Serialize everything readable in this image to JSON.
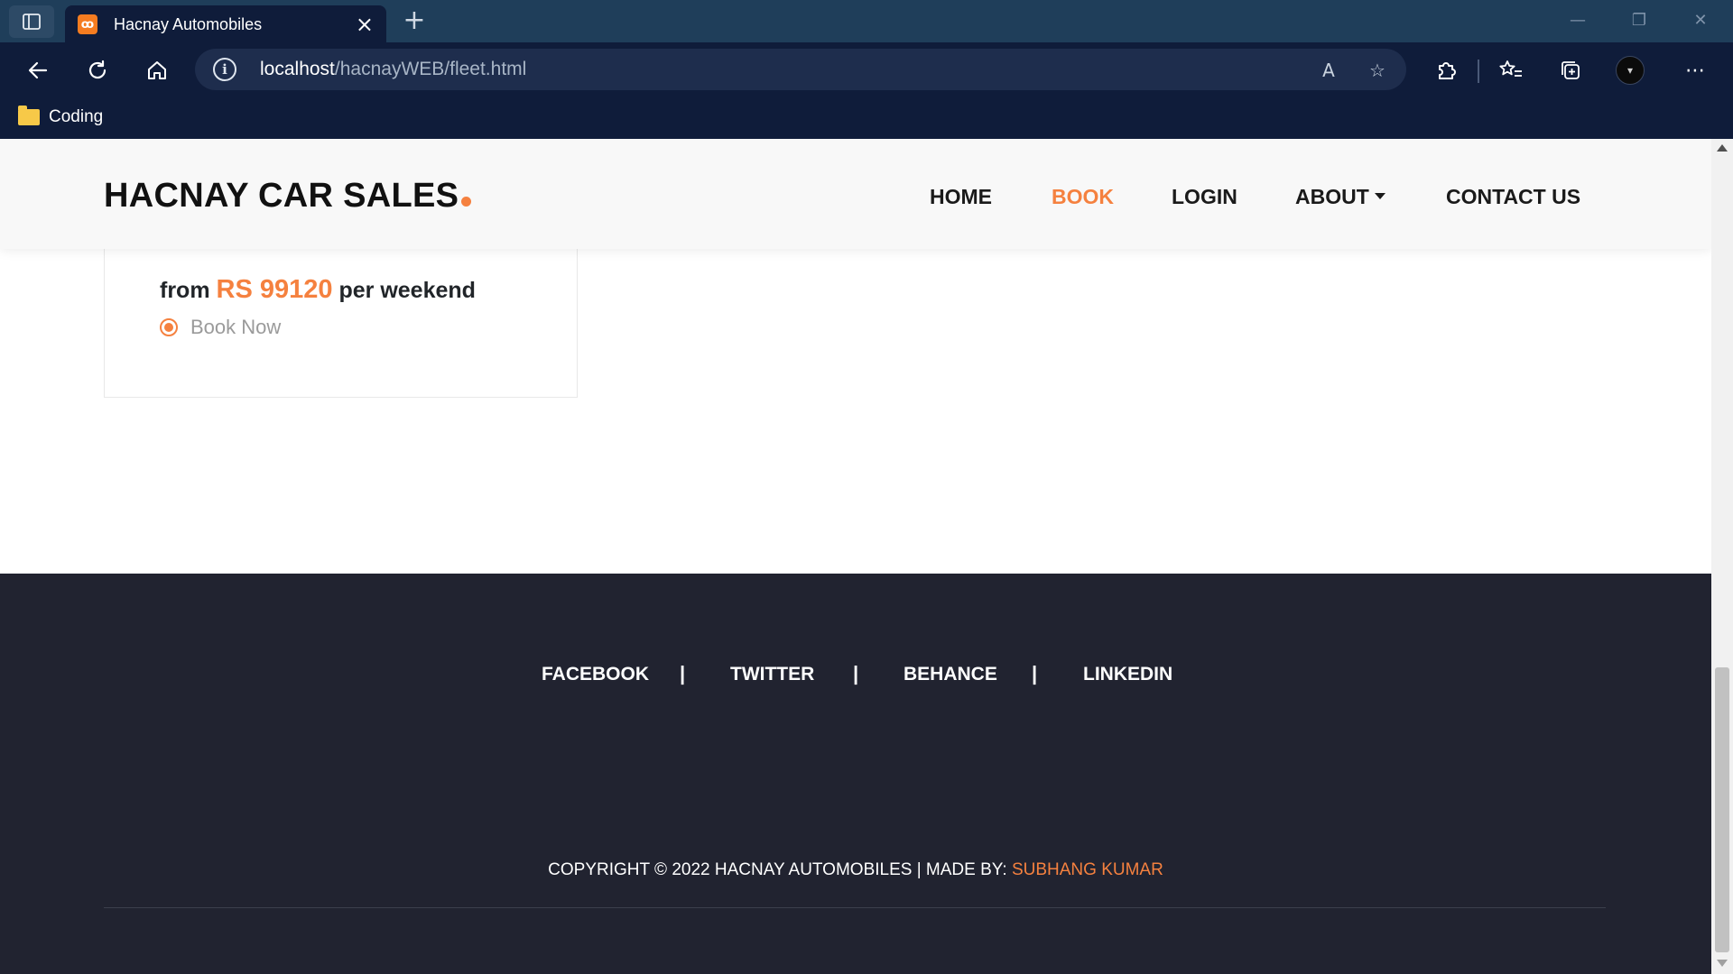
{
  "browser": {
    "tab_title": "Hacnay Automobiles",
    "tab_favicon": "xampp-icon",
    "new_tab_label": "+",
    "address_host": "localhost",
    "address_path": "/hacnayWEB/fleet.html",
    "bookmarks": [
      {
        "label": "Coding",
        "icon": "folder-icon"
      }
    ]
  },
  "header": {
    "logo": "HACNAY CAR SALES",
    "nav": [
      {
        "label": "HOME",
        "active": false
      },
      {
        "label": "BOOK",
        "active": true
      },
      {
        "label": "LOGIN",
        "active": false
      },
      {
        "label": "ABOUT",
        "active": false,
        "dropdown": true
      },
      {
        "label": "CONTACT US",
        "active": false
      }
    ],
    "accent_color": "#f5813f"
  },
  "card": {
    "price_prefix": "from",
    "price_amount": "RS 99120",
    "price_suffix": "per weekend",
    "book_label": "Book Now"
  },
  "footer": {
    "social_links": [
      "FACEBOOK",
      "TWITTER",
      "BEHANCE",
      "LINKEDIN"
    ],
    "separator": "|",
    "copyright_text": "COPYRIGHT © 2022 HACNAY AUTOMOBILES | MADE BY:",
    "author": "SUBHANG KUMAR",
    "background": "#212330"
  }
}
